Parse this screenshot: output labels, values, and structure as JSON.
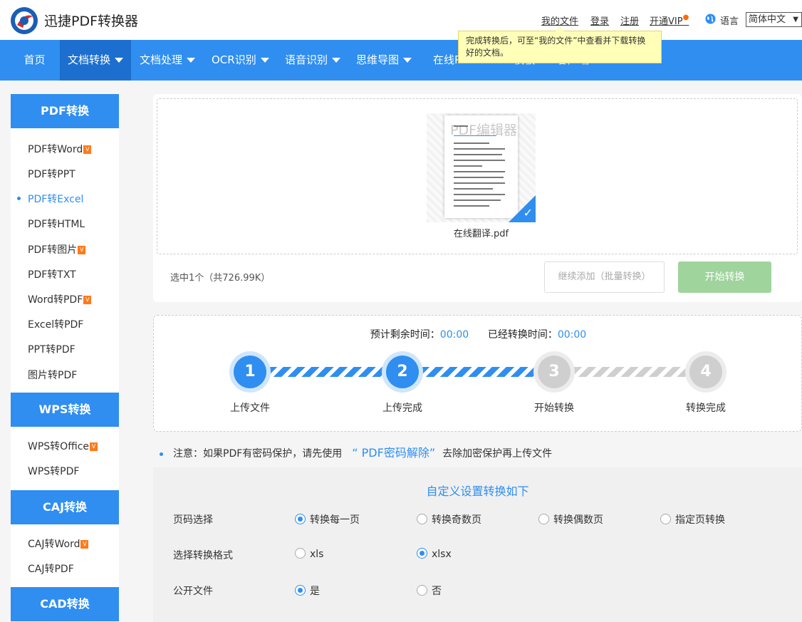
{
  "header": {
    "brand": "迅捷PDF转换器",
    "links": [
      "我的文件",
      "登录",
      "注册",
      "开通VIP"
    ],
    "language_label": "语言",
    "language_value": "简体中文"
  },
  "nav": {
    "items": [
      "首页",
      "文档转换",
      "文档处理",
      "OCR识别",
      "语音识别",
      "思维导图",
      "在线PS",
      "PPT模板",
      "客户端"
    ]
  },
  "tooltip": "完成转换后，可至“我的文件”中查看并下载转换好的文档。",
  "sidebar": {
    "sections": [
      {
        "title": "PDF转换",
        "items": [
          "PDF转Word",
          "PDF转PPT",
          "PDF转Excel",
          "PDF转HTML",
          "PDF转图片",
          "PDF转TXT",
          "Word转PDF",
          "Excel转PDF",
          "PPT转PDF",
          "图片转PDF"
        ]
      },
      {
        "title": "WPS转换",
        "items": [
          "WPS转Office",
          "WPS转PDF"
        ]
      },
      {
        "title": "CAJ转换",
        "items": [
          "CAJ转Word",
          "CAJ转PDF"
        ]
      },
      {
        "title": "CAD转换",
        "items": []
      }
    ],
    "active_item": "PDF转Excel"
  },
  "upload": {
    "thumb_watermark": "PDF编辑器",
    "file_name": "在线翻译.pdf",
    "selection_info": "选中1个（共726.99K）",
    "add_button": "继续添加（批量转换）",
    "start_button": "开始转换"
  },
  "progress": {
    "remaining_label": "预计剩余时间：",
    "remaining_value": "00:00",
    "elapsed_label": "已经转换时间：",
    "elapsed_value": "00:00",
    "steps": [
      {
        "num": "1",
        "label": "上传文件"
      },
      {
        "num": "2",
        "label": "上传完成"
      },
      {
        "num": "3",
        "label": "开始转换"
      },
      {
        "num": "4",
        "label": "转换完成"
      }
    ],
    "completed_steps": 2
  },
  "notice": {
    "prefix": "注意：如果PDF有密码保护，请先使用",
    "link": "“ PDF密码解除”",
    "suffix": "去除加密保护再上传文件"
  },
  "settings": {
    "title": "自定义设置转换如下",
    "page_label": "页码选择",
    "page_options": [
      "转换每一页",
      "转换奇数页",
      "转换偶数页",
      "指定页转换"
    ],
    "page_selected": "转换每一页",
    "format_label": "选择转换格式",
    "format_options": [
      "xls",
      "xlsx"
    ],
    "format_selected": "xlsx",
    "public_label": "公开文件",
    "public_options": [
      "是",
      "否"
    ],
    "public_selected": "是"
  },
  "colors": {
    "primary": "#2f8ef0",
    "nav_active": "#1c6fcf",
    "start_button": "#9fd49d",
    "vip_fire": "#ff6a00"
  }
}
